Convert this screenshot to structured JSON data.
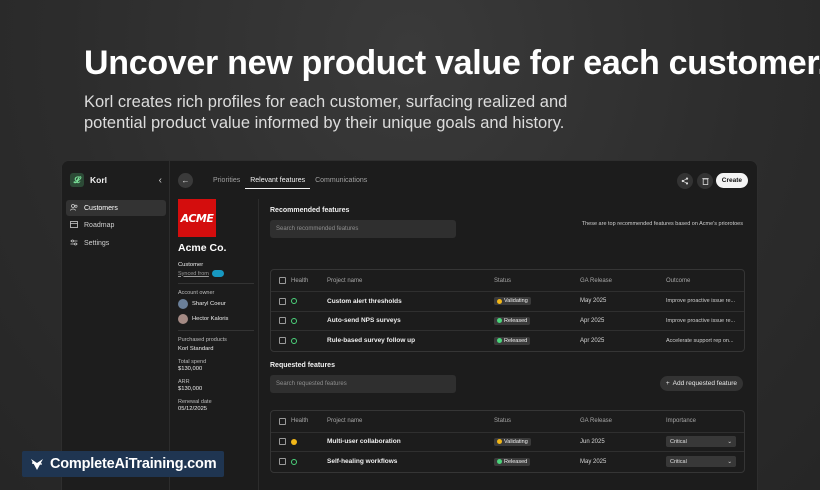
{
  "hero": {
    "title": "Uncover new product value for each customer.",
    "subtitle": "Korl creates rich profiles for each customer, surfacing realized and potential product value informed by their unique goals and history."
  },
  "sidebar": {
    "brand": "Korl",
    "brand_logo_glyph": "𝓛",
    "collapse_icon": "‹",
    "items": [
      {
        "label": "Customers",
        "icon": "users-icon",
        "active": true
      },
      {
        "label": "Roadmap",
        "icon": "roadmap-icon",
        "active": false
      },
      {
        "label": "Settings",
        "icon": "settings-icon",
        "active": false
      }
    ]
  },
  "topbar": {
    "tabs": [
      "Priorities",
      "Relevant features",
      "Communications"
    ],
    "active_tab": "Relevant features",
    "create_label": "Create"
  },
  "profile": {
    "logo_text": "ACME",
    "company": "Acme Co.",
    "type": "Customer",
    "synced_from": "Synced from",
    "account_owner_label": "Account owner",
    "owners": [
      "Sharyl Coeur",
      "Hector Kaloris"
    ],
    "purchased_label": "Purchased products",
    "purchased_value": "Korl Standard",
    "total_spend_label": "Total spend",
    "total_spend_value": "$130,000",
    "arr_label": "ARR",
    "arr_value": "$130,000",
    "renewal_label": "Renewal date",
    "renewal_value": "05/12/2025"
  },
  "recommended": {
    "title": "Recommended features",
    "search_placeholder": "Search recommended features",
    "note": "These are top recommended features based on Acme's priorotoes",
    "headers": {
      "health": "Health",
      "name": "Project name",
      "status": "Status",
      "ga": "GA Release",
      "outcome": "Outcome"
    },
    "rows": [
      {
        "name": "Custom alert thresholds",
        "status": "Validating",
        "status_kind": "y",
        "ga": "May 2025",
        "outcome": "Improve proactive issue re..."
      },
      {
        "name": "Auto-send NPS surveys",
        "status": "Released",
        "status_kind": "g",
        "ga": "Apr 2025",
        "outcome": "Improve proactive issue re..."
      },
      {
        "name": "Rule-based survey follow up",
        "status": "Released",
        "status_kind": "g",
        "ga": "Apr 2025",
        "outcome": "Accelerate support rep on..."
      }
    ]
  },
  "requested": {
    "title": "Requested features",
    "search_placeholder": "Search requested features",
    "add_label": "Add requested feature",
    "headers": {
      "health": "Health",
      "name": "Project name",
      "status": "Status",
      "ga": "GA Release",
      "importance": "Importance"
    },
    "rows": [
      {
        "name": "Multi-user collaboration",
        "status": "Validating",
        "status_kind": "y",
        "health": "warn",
        "ga": "Jun 2025",
        "importance": "Critical"
      },
      {
        "name": "Self-healing workflows",
        "status": "Released",
        "status_kind": "g",
        "health": "ok",
        "ga": "May 2025",
        "importance": "Critical"
      }
    ]
  },
  "watermark": {
    "text": "CompleteAiTraining.com"
  }
}
